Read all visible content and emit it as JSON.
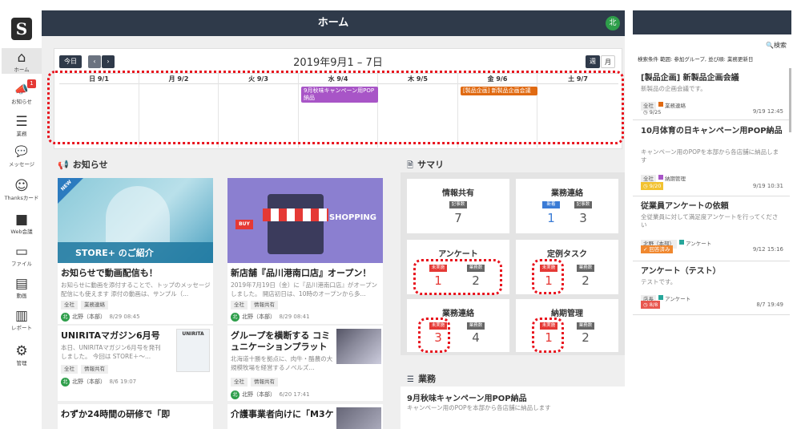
{
  "nav": {
    "logo": "S",
    "items": [
      {
        "icon": "⌂",
        "label": "ホーム"
      },
      {
        "icon": "📣",
        "label": "お知らせ",
        "badge": "1"
      },
      {
        "icon": "☰",
        "label": "業務"
      },
      {
        "icon": "💬",
        "label": "メッセージ"
      },
      {
        "icon": "☺",
        "label": "Thanksカード"
      },
      {
        "icon": "■",
        "label": "Web会議"
      },
      {
        "icon": "▭",
        "label": "ファイル"
      },
      {
        "icon": "▤",
        "label": "動画"
      },
      {
        "icon": "▥",
        "label": "レポート"
      },
      {
        "icon": "⚙",
        "label": "管理"
      }
    ]
  },
  "header": {
    "title": "ホーム",
    "avatar": "北"
  },
  "calendar": {
    "today": "今日",
    "prev": "‹",
    "next": "›",
    "title": "2019年9月1 – 7日",
    "week": "週",
    "month": "月",
    "days": [
      "日 9/1",
      "月 9/2",
      "火 9/3",
      "水 9/4",
      "木 9/5",
      "金 9/6",
      "土 9/7"
    ],
    "events": [
      {
        "text": "9月秋味キャンペーン用POP納品",
        "color": "#a855c7"
      },
      {
        "text": "[製品企画] 新製品企画会議",
        "color": "#e06a12"
      }
    ]
  },
  "notices": {
    "title": "お知らせ",
    "cards": [
      {
        "title": "お知らせで動画配信も！",
        "text": "お知らせに動画を添付することで、トップのメッセージ配信にも使えます 添付の動画は、サンプル（...",
        "tags": [
          "全社",
          "業務連絡"
        ],
        "author": "北野（本部）",
        "date": "8/29 08:45",
        "img_caption": "STORE+ のご紹介",
        "new": "NEW"
      },
      {
        "title": "新店舗『品川港南口店』オープン！",
        "text": "2019年7月19日（金）に『品川港南口店』がオープンしました。 開店初日は、10時のオープンから多...",
        "tags": [
          "全社",
          "情報共有"
        ],
        "author": "北野（本部）",
        "date": "8/29 08:41",
        "img_caption": "SHOPPING"
      },
      {
        "title": "UNIRITAマガジン6月号",
        "text": "本日、UNIRITAマガジン6月号を発刊しました。 今回は STORE＋～...",
        "tags": [
          "全社",
          "情報共有"
        ],
        "author": "北野（本部）",
        "date": "8/6 19:07",
        "thumb": "UNIRITA"
      },
      {
        "title": "グループを横断する コミュニケーションプラットフ...",
        "text": "北海道十勝を拠点に、肉牛・酪農の大規模牧場を経営するノベルズ...",
        "tags": [
          "全社",
          "情報共有"
        ],
        "author": "北野（本部）",
        "date": "6/20 17:41"
      },
      {
        "title": "わずか24時間の研修で「即"
      },
      {
        "title": "介護事業者向けに「M3ケ"
      }
    ]
  },
  "summary": {
    "title": "サマリ",
    "boxes": [
      {
        "title": "情報共有",
        "items": [
          {
            "label": "記事数",
            "value": "7",
            "color": "#666",
            "num_color": "#555"
          }
        ]
      },
      {
        "title": "業務連絡",
        "items": [
          {
            "label": "新着",
            "value": "1",
            "color": "#3a7bd5",
            "num_color": "#3a7bd5"
          },
          {
            "label": "記事数",
            "value": "3",
            "color": "#666",
            "num_color": "#555"
          }
        ]
      },
      {
        "title": "アンケート",
        "items": [
          {
            "label": "未実施",
            "value": "1",
            "color": "#e53935",
            "num_color": "#e53935"
          },
          {
            "label": "業務数",
            "value": "2",
            "color": "#666",
            "num_color": "#555"
          }
        ]
      },
      {
        "title": "定例タスク",
        "items": [
          {
            "label": "未実施",
            "value": "1",
            "color": "#e53935",
            "num_color": "#e53935"
          },
          {
            "label": "業務数",
            "value": "2",
            "color": "#666",
            "num_color": "#555"
          }
        ]
      },
      {
        "title": "業務連絡",
        "items": [
          {
            "label": "未実施",
            "value": "3",
            "color": "#e53935",
            "num_color": "#e53935"
          },
          {
            "label": "業務数",
            "value": "4",
            "color": "#666",
            "num_color": "#555"
          }
        ]
      },
      {
        "title": "納期管理",
        "items": [
          {
            "label": "未実施",
            "value": "1",
            "color": "#e53935",
            "num_color": "#e53935"
          },
          {
            "label": "業務数",
            "value": "2",
            "color": "#666",
            "num_color": "#555"
          }
        ]
      }
    ]
  },
  "tasks": {
    "title": "業務",
    "item_title": "9月秋味キャンペーン用POP納品",
    "item_text": "キャンペーン用のPOPを本部から各店舗に納品します"
  },
  "right_panel": {
    "search": "検索",
    "filter": "検索条件 範囲: 参加グループ, 並び順: 業務更新日",
    "items": [
      {
        "title": "[製品企画] 新製品企画会議",
        "text": "新製品の企画会議です。",
        "tags": [
          {
            "label": "全社",
            "sq": ""
          },
          {
            "label": "業務連絡",
            "sq": "#e06a12"
          }
        ],
        "badge": "◷ 9/25",
        "badge_bg": "#fff",
        "badge_color": "#555",
        "date": "9/19 12:45"
      },
      {
        "title": "10月体育の日キャンペーン用POP納品",
        "text": "キャンペーン用のPOPを本部から各店舗に納品します",
        "tags": [
          {
            "label": "全社",
            "sq": ""
          },
          {
            "label": "納期管理",
            "sq": "#a855c7"
          }
        ],
        "badge": "◷ 9/20",
        "badge_bg": "#f2c230",
        "badge_color": "#fff",
        "date": "9/19 10:31"
      },
      {
        "title": "従業員アンケートの依頼",
        "text": "全従業員に対して満足度アンケートを行ってください",
        "tags": [
          {
            "label": "北野（本部）",
            "sq": ""
          },
          {
            "label": "アンケート",
            "sq": "#26a69a"
          }
        ],
        "badge": "✓ 回答済み",
        "badge_bg": "#f0882f",
        "badge_color": "#fff",
        "date": "9/12 15:16"
      },
      {
        "title": "アンケート（テスト）",
        "text": "テストです。",
        "tags": [
          {
            "label": "店長",
            "sq": ""
          },
          {
            "label": "アンケート",
            "sq": "#26a69a"
          }
        ],
        "badge": "◷ 8/8",
        "badge_bg": "#e8574f",
        "badge_color": "#fff",
        "date": "8/7 19:49"
      }
    ]
  }
}
